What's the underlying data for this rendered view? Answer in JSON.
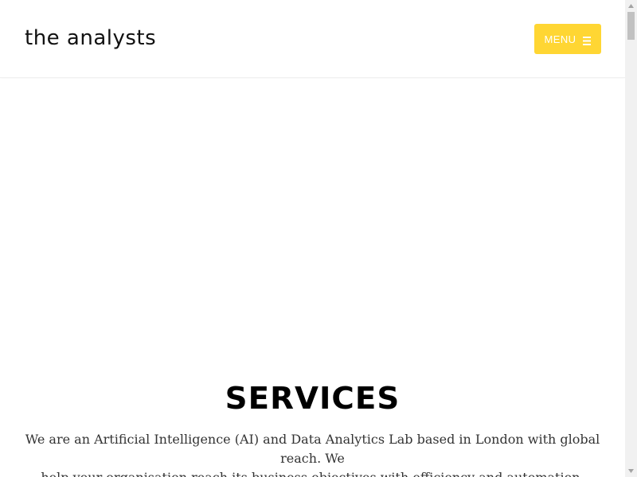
{
  "header": {
    "logo_text": "the analysts",
    "menu_label": "MENU",
    "menu_icon": "hamburger-icon"
  },
  "colors": {
    "menu_button_bg": "#ffd633",
    "menu_button_text": "#ffffff",
    "heading": "#000000",
    "body_text": "#333333"
  },
  "services": {
    "title": "SERVICES",
    "line1": "We are an Artificial Intelligence (AI) and Data Analytics Lab based in London with global reach. We",
    "line2": "help your organisation reach its business objectives with efficiency and automation."
  },
  "scrollbar": {
    "up_icon": "scroll-up-arrow-icon",
    "down_icon": "scroll-down-arrow-icon"
  }
}
